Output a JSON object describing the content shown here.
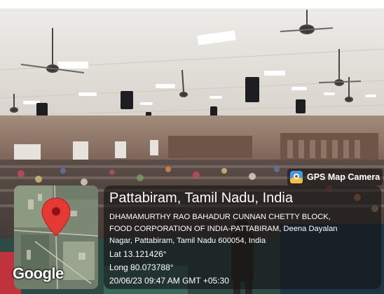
{
  "badge": {
    "label": "GPS Map Camera",
    "icon": "gps-map-camera-icon"
  },
  "location": {
    "title": "Pattabiram, Tamil Nadu, India",
    "address_lines": [
      "DHAMAMURTHY RAO BAHADUR CUNNAN CHETTY BLOCK,",
      "FOOD CORPORATION OF INDIA-PATTABIRAM, Deena Dayalan",
      "Nagar, Pattabiram, Tamil Nadu 600054, India"
    ],
    "lat": "Lat 13.121426°",
    "long": "Long 80.073788°",
    "datetime": "20/06/23 09:47 AM GMT +05:30"
  },
  "map": {
    "brand": "Google",
    "pin_color": "#e53935",
    "pin_icon": "location-pin-icon"
  }
}
